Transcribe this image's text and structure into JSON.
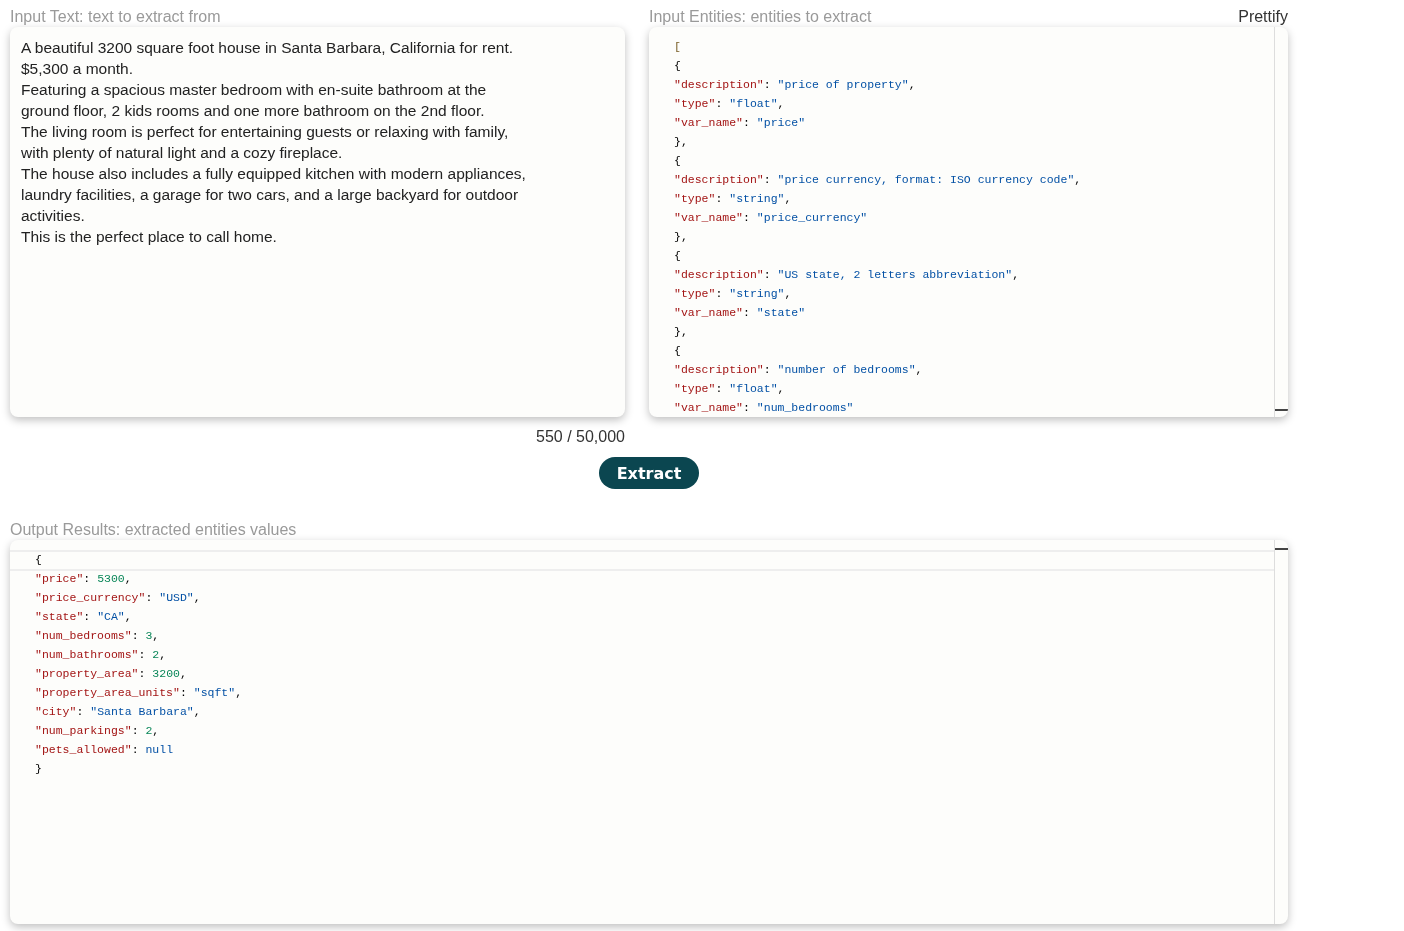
{
  "input_text": {
    "label": "Input Text: text to extract from",
    "value": "A beautiful 3200 square foot house in Santa Barbara, California for rent.\n$5,300 a month.\nFeaturing a spacious master bedroom with en-suite bathroom at the\nground floor, 2 kids rooms and one more bathroom on the 2nd floor.\nThe living room is perfect for entertaining guests or relaxing with family,\nwith plenty of natural light and a cozy fireplace.\nThe house also includes a fully equipped kitchen with modern appliances,\nlaundry facilities, a garage for two cars, and a large backyard for outdoor\nactivities.\nThis is the perfect place to call home.",
    "counter": "550 / 50,000"
  },
  "input_entities": {
    "label": "Input Entities: entities to extract",
    "prettify": "Prettify",
    "code": {
      "open": [
        {
          "kind": "bracket",
          "text": "["
        }
      ],
      "children": [
        {
          "open": [
            {
              "kind": "punct",
              "text": "{"
            }
          ],
          "children": [
            {
              "tokens": [
                {
                  "kind": "key",
                  "text": "\"description\""
                },
                {
                  "kind": "punct",
                  "text": ": "
                },
                {
                  "kind": "string",
                  "text": "\"price of property\""
                },
                {
                  "kind": "punct",
                  "text": ","
                }
              ]
            },
            {
              "tokens": [
                {
                  "kind": "key",
                  "text": "\"type\""
                },
                {
                  "kind": "punct",
                  "text": ": "
                },
                {
                  "kind": "string",
                  "text": "\"float\""
                },
                {
                  "kind": "punct",
                  "text": ","
                }
              ]
            },
            {
              "tokens": [
                {
                  "kind": "key",
                  "text": "\"var_name\""
                },
                {
                  "kind": "punct",
                  "text": ": "
                },
                {
                  "kind": "string",
                  "text": "\"price\""
                }
              ]
            }
          ],
          "close": [
            {
              "kind": "punct",
              "text": "},"
            }
          ]
        },
        {
          "open": [
            {
              "kind": "punct",
              "text": "{"
            }
          ],
          "children": [
            {
              "tokens": [
                {
                  "kind": "key",
                  "text": "\"description\""
                },
                {
                  "kind": "punct",
                  "text": ": "
                },
                {
                  "kind": "string",
                  "text": "\"price currency, format: ISO currency code\""
                },
                {
                  "kind": "punct",
                  "text": ","
                }
              ]
            },
            {
              "tokens": [
                {
                  "kind": "key",
                  "text": "\"type\""
                },
                {
                  "kind": "punct",
                  "text": ": "
                },
                {
                  "kind": "string",
                  "text": "\"string\""
                },
                {
                  "kind": "punct",
                  "text": ","
                }
              ]
            },
            {
              "tokens": [
                {
                  "kind": "key",
                  "text": "\"var_name\""
                },
                {
                  "kind": "punct",
                  "text": ": "
                },
                {
                  "kind": "string",
                  "text": "\"price_currency\""
                }
              ]
            }
          ],
          "close": [
            {
              "kind": "punct",
              "text": "},"
            }
          ]
        },
        {
          "open": [
            {
              "kind": "punct",
              "text": "{"
            }
          ],
          "children": [
            {
              "tokens": [
                {
                  "kind": "key",
                  "text": "\"description\""
                },
                {
                  "kind": "punct",
                  "text": ": "
                },
                {
                  "kind": "string",
                  "text": "\"US state, 2 letters abbreviation\""
                },
                {
                  "kind": "punct",
                  "text": ","
                }
              ]
            },
            {
              "tokens": [
                {
                  "kind": "key",
                  "text": "\"type\""
                },
                {
                  "kind": "punct",
                  "text": ": "
                },
                {
                  "kind": "string",
                  "text": "\"string\""
                },
                {
                  "kind": "punct",
                  "text": ","
                }
              ]
            },
            {
              "tokens": [
                {
                  "kind": "key",
                  "text": "\"var_name\""
                },
                {
                  "kind": "punct",
                  "text": ": "
                },
                {
                  "kind": "string",
                  "text": "\"state\""
                }
              ]
            }
          ],
          "close": [
            {
              "kind": "punct",
              "text": "},"
            }
          ]
        },
        {
          "open": [
            {
              "kind": "punct",
              "text": "{"
            }
          ],
          "children": [
            {
              "tokens": [
                {
                  "kind": "key",
                  "text": "\"description\""
                },
                {
                  "kind": "punct",
                  "text": ": "
                },
                {
                  "kind": "string",
                  "text": "\"number of bedrooms\""
                },
                {
                  "kind": "punct",
                  "text": ","
                }
              ]
            },
            {
              "tokens": [
                {
                  "kind": "key",
                  "text": "\"type\""
                },
                {
                  "kind": "punct",
                  "text": ": "
                },
                {
                  "kind": "string",
                  "text": "\"float\""
                },
                {
                  "kind": "punct",
                  "text": ","
                }
              ]
            },
            {
              "tokens": [
                {
                  "kind": "key",
                  "text": "\"var_name\""
                },
                {
                  "kind": "punct",
                  "text": ": "
                },
                {
                  "kind": "string",
                  "text": "\"num_bedrooms\""
                }
              ]
            }
          ]
        }
      ]
    }
  },
  "extract_button": "Extract",
  "output": {
    "label": "Output Results: extracted entities values",
    "code": {
      "open": [
        {
          "kind": "punct",
          "text": "{"
        }
      ],
      "children": [
        {
          "tokens": [
            {
              "kind": "key",
              "text": "\"price\""
            },
            {
              "kind": "punct",
              "text": ": "
            },
            {
              "kind": "number",
              "text": "5300"
            },
            {
              "kind": "punct",
              "text": ","
            }
          ]
        },
        {
          "tokens": [
            {
              "kind": "key",
              "text": "\"price_currency\""
            },
            {
              "kind": "punct",
              "text": ": "
            },
            {
              "kind": "string",
              "text": "\"USD\""
            },
            {
              "kind": "punct",
              "text": ","
            }
          ]
        },
        {
          "tokens": [
            {
              "kind": "key",
              "text": "\"state\""
            },
            {
              "kind": "punct",
              "text": ": "
            },
            {
              "kind": "string",
              "text": "\"CA\""
            },
            {
              "kind": "punct",
              "text": ","
            }
          ]
        },
        {
          "tokens": [
            {
              "kind": "key",
              "text": "\"num_bedrooms\""
            },
            {
              "kind": "punct",
              "text": ": "
            },
            {
              "kind": "number",
              "text": "3"
            },
            {
              "kind": "punct",
              "text": ","
            }
          ]
        },
        {
          "tokens": [
            {
              "kind": "key",
              "text": "\"num_bathrooms\""
            },
            {
              "kind": "punct",
              "text": ": "
            },
            {
              "kind": "number",
              "text": "2"
            },
            {
              "kind": "punct",
              "text": ","
            }
          ]
        },
        {
          "tokens": [
            {
              "kind": "key",
              "text": "\"property_area\""
            },
            {
              "kind": "punct",
              "text": ": "
            },
            {
              "kind": "number",
              "text": "3200"
            },
            {
              "kind": "punct",
              "text": ","
            }
          ]
        },
        {
          "tokens": [
            {
              "kind": "key",
              "text": "\"property_area_units\""
            },
            {
              "kind": "punct",
              "text": ": "
            },
            {
              "kind": "string",
              "text": "\"sqft\""
            },
            {
              "kind": "punct",
              "text": ","
            }
          ]
        },
        {
          "tokens": [
            {
              "kind": "key",
              "text": "\"city\""
            },
            {
              "kind": "punct",
              "text": ": "
            },
            {
              "kind": "string",
              "text": "\"Santa Barbara\""
            },
            {
              "kind": "punct",
              "text": ","
            }
          ]
        },
        {
          "tokens": [
            {
              "kind": "key",
              "text": "\"num_parkings\""
            },
            {
              "kind": "punct",
              "text": ": "
            },
            {
              "kind": "number",
              "text": "2"
            },
            {
              "kind": "punct",
              "text": ","
            }
          ]
        },
        {
          "tokens": [
            {
              "kind": "key",
              "text": "\"pets_allowed\""
            },
            {
              "kind": "punct",
              "text": ": "
            },
            {
              "kind": "null",
              "text": "null"
            }
          ]
        }
      ],
      "close": [
        {
          "kind": "punct",
          "text": "}"
        }
      ]
    }
  }
}
